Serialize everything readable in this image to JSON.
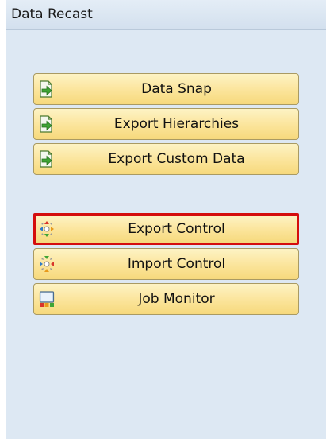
{
  "panel": {
    "title": "Data Recast"
  },
  "buttons": [
    {
      "label": "Data Snap",
      "icon": "export-doc-icon"
    },
    {
      "label": "Export Hierarchies",
      "icon": "export-doc-icon"
    },
    {
      "label": "Export Custom Data",
      "icon": "export-doc-icon"
    },
    {
      "label": "Export Control",
      "icon": "export-control-icon",
      "selected": true
    },
    {
      "label": "Import Control",
      "icon": "import-control-icon"
    },
    {
      "label": "Job Monitor",
      "icon": "job-monitor-icon"
    }
  ],
  "colors": {
    "panel_background": "#dde8f3",
    "button_fill": "#fbe49a",
    "selection_border": "#d40d0d"
  }
}
